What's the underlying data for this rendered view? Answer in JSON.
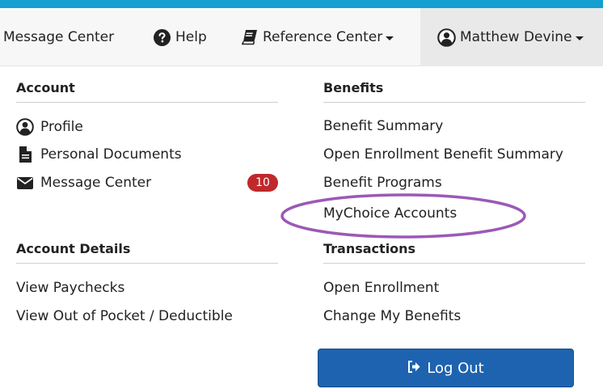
{
  "navbar": {
    "message_center": "Message Center",
    "help": "Help",
    "reference_center": "Reference Center",
    "user_name": "Matthew Devine"
  },
  "account": {
    "heading": "Account",
    "items": [
      {
        "label": "Profile",
        "icon": "user-circle-icon"
      },
      {
        "label": "Personal Documents",
        "icon": "document-icon"
      },
      {
        "label": "Message Center",
        "icon": "envelope-icon",
        "badge": "10"
      }
    ]
  },
  "account_details": {
    "heading": "Account Details",
    "items": [
      {
        "label": "View Paychecks"
      },
      {
        "label": "View Out of Pocket / Deductible"
      }
    ]
  },
  "benefits": {
    "heading": "Benefits",
    "items": [
      {
        "label": "Benefit Summary"
      },
      {
        "label": "Open Enrollment Benefit Summary"
      },
      {
        "label": "Benefit Programs"
      },
      {
        "label": "MyChoice Accounts"
      }
    ]
  },
  "transactions": {
    "heading": "Transactions",
    "items": [
      {
        "label": "Open Enrollment"
      },
      {
        "label": "Change My Benefits"
      }
    ]
  },
  "logout": {
    "label": "Log Out"
  },
  "colors": {
    "top_strip": "#139fd0",
    "badge": "#c0292b",
    "logout_button": "#1e63b0",
    "highlight_ellipse": "#9b59b6"
  }
}
